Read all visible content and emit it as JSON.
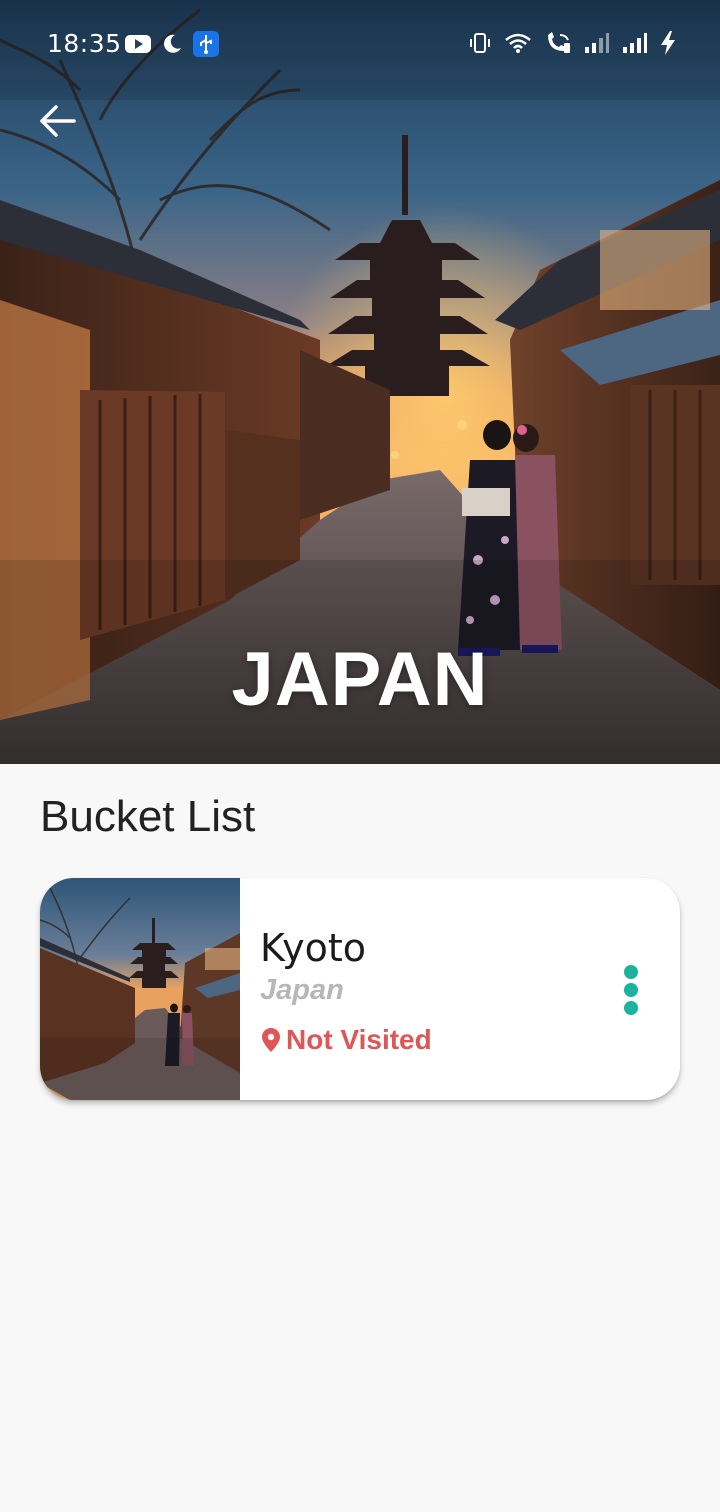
{
  "status_bar": {
    "time": "18:35",
    "left_icons": [
      "youtube-icon",
      "moon-icon",
      "usb-icon"
    ],
    "right_icons": [
      "vibrate-icon",
      "wifi-icon",
      "wifi-calling-icon",
      "signal-icon",
      "signal-icon",
      "charging-icon"
    ]
  },
  "header": {
    "back_icon": "arrow-back-icon",
    "title": "JAPAN"
  },
  "section": {
    "title": "Bucket List"
  },
  "bucket_list": [
    {
      "name": "Kyoto",
      "country": "Japan",
      "status": "Not Visited",
      "status_icon": "location-pin-icon",
      "status_color": "#e05555",
      "menu_icon": "more-vertical-icon",
      "menu_color": "#1ab39b"
    }
  ],
  "colors": {
    "background": "#f8f8f8",
    "accent": "#1ab39b",
    "not_visited": "#e05555"
  }
}
